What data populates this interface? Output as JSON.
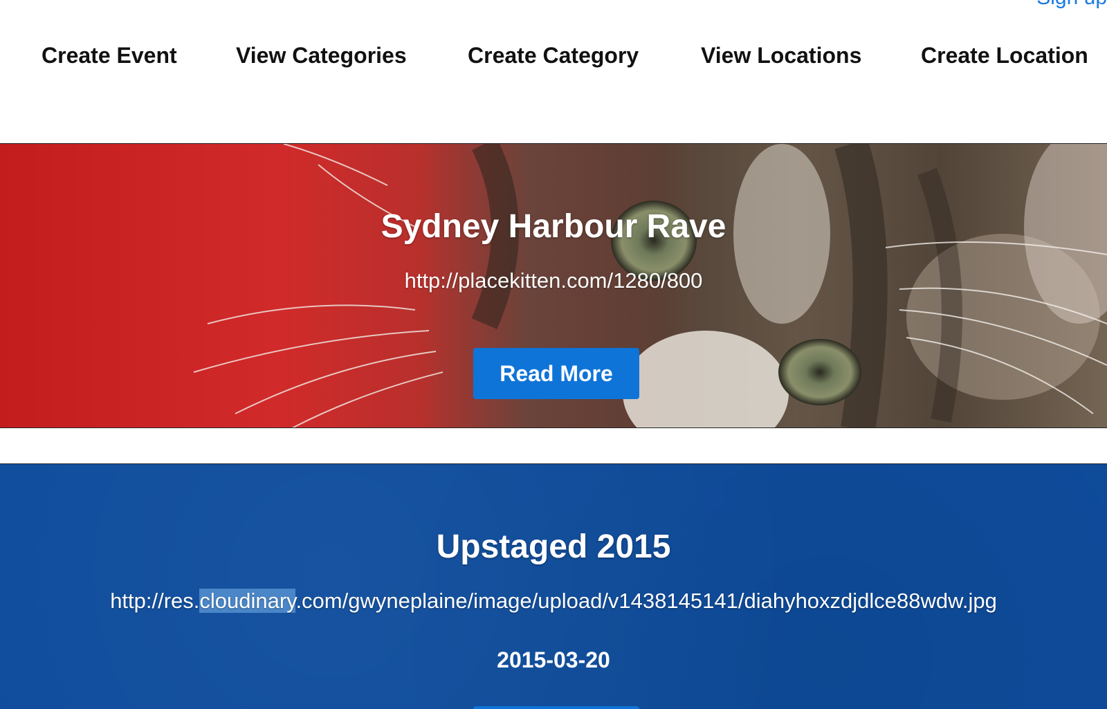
{
  "header": {
    "signup_label": "Sign up"
  },
  "nav": {
    "items": [
      {
        "label": "Create Event"
      },
      {
        "label": "View Categories"
      },
      {
        "label": "Create Category"
      },
      {
        "label": "View Locations"
      },
      {
        "label": "Create Location"
      }
    ]
  },
  "events": [
    {
      "title": "Sydney Harbour Rave",
      "image_url": "http://placekitten.com/1280/800",
      "button_label": "Read More"
    },
    {
      "title": "Upstaged 2015",
      "image_url_prefix": "http://res.",
      "image_url_selected": "cloudinary",
      "image_url_suffix": ".com/gwyneplaine/image/upload/v1438145141/diahyhoxzdjdlce88wdw.jpg",
      "date": "2015-03-20"
    }
  ],
  "colors": {
    "link": "#1a7ae0",
    "button": "#0f74d8",
    "blue_banner": "#0e4c9c",
    "red_banner": "#c41d1e",
    "selection": "#4a86c8"
  }
}
